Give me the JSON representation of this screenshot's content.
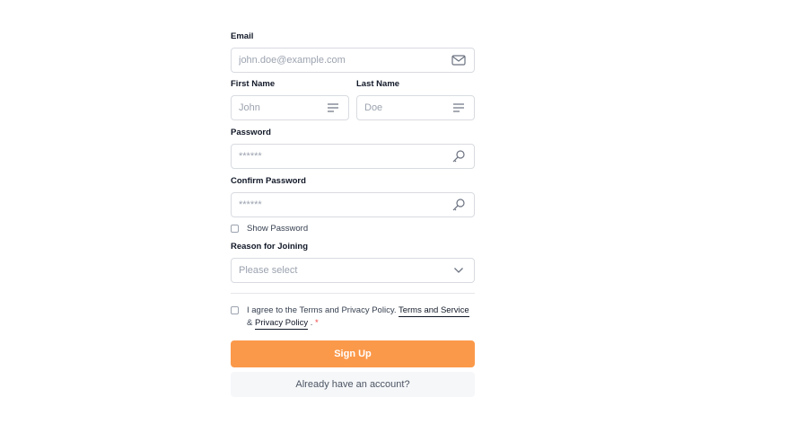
{
  "form": {
    "email": {
      "label": "Email",
      "placeholder": "john.doe@example.com",
      "icon": "mail-icon"
    },
    "first_name": {
      "label": "First Name",
      "placeholder": "John",
      "icon": "text-lines-icon"
    },
    "last_name": {
      "label": "Last Name",
      "placeholder": "Doe",
      "icon": "text-lines-icon"
    },
    "password": {
      "label": "Password",
      "placeholder": "******",
      "icon": "key-icon"
    },
    "confirm_password": {
      "label": "Confirm Password",
      "placeholder": "******",
      "icon": "key-icon"
    },
    "show_password": {
      "label": "Show Password",
      "checked": false
    },
    "reason": {
      "label": "Reason for Joining",
      "selected": "Please select",
      "icon": "chevron-down-icon"
    },
    "agreement": {
      "text": "I agree to the Terms and Privacy Policy.",
      "terms_link": "Terms and Service",
      "ampersand": "&",
      "privacy_link": "Privacy Policy",
      "suffix": ".",
      "required_mark": "*",
      "checked": false
    },
    "signup_button": "Sign Up",
    "login_link": "Already have an account?"
  },
  "colors": {
    "primary": "#fb994a",
    "border": "#d8dbe0",
    "placeholder": "#9ca3af",
    "required": "#ef4444",
    "secondary_bg": "#f6f7f9"
  }
}
